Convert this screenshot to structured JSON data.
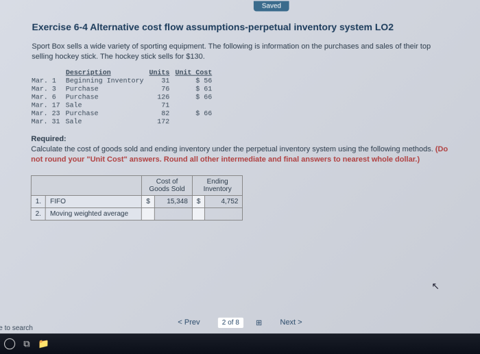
{
  "topBadge": "Saved",
  "title": "Exercise 6-4 Alternative cost flow assumptions-perpetual inventory system LO2",
  "intro": "Sport Box sells a wide variety of sporting equipment. The following is information on the purchases and sales of their top selling hockey stick. The hockey stick sells for $130.",
  "txHeaders": {
    "desc": "Description",
    "units": "Units",
    "unitCost": "Unit Cost"
  },
  "tx": [
    {
      "date": "Mar.  1",
      "desc": "Beginning Inventory",
      "units": "31",
      "cost": "$ 56"
    },
    {
      "date": "Mar.  3",
      "desc": "Purchase",
      "units": "76",
      "cost": "$ 61"
    },
    {
      "date": "Mar.  6",
      "desc": "Purchase",
      "units": "126",
      "cost": "$ 66"
    },
    {
      "date": "Mar. 17",
      "desc": "Sale",
      "units": "71",
      "cost": ""
    },
    {
      "date": "Mar. 23",
      "desc": "Purchase",
      "units": "82",
      "cost": "$ 66"
    },
    {
      "date": "Mar. 31",
      "desc": "Sale",
      "units": "172",
      "cost": ""
    }
  ],
  "requiredLabel": "Required:",
  "requiredText": "Calculate the cost of goods sold and ending inventory under the perpetual inventory system using the following methods. ",
  "requiredNote": "(Do not round your \"Unit Cost\" answers. Round all other intermediate and final answers to nearest whole dollar.)",
  "ansHeaders": {
    "cogs": "Cost of Goods Sold",
    "ei": "Ending Inventory"
  },
  "ansRows": [
    {
      "n": "1.",
      "label": "FIFO",
      "cur1": "$",
      "cogs": "15,348",
      "cur2": "$",
      "ei": "4,752"
    },
    {
      "n": "2.",
      "label": "Moving weighted average",
      "cur1": "",
      "cogs": "",
      "cur2": "",
      "ei": ""
    }
  ],
  "nav": {
    "prev": "Prev",
    "page": "2 of 8",
    "next": "Next"
  },
  "searchPrompt": "e to search"
}
